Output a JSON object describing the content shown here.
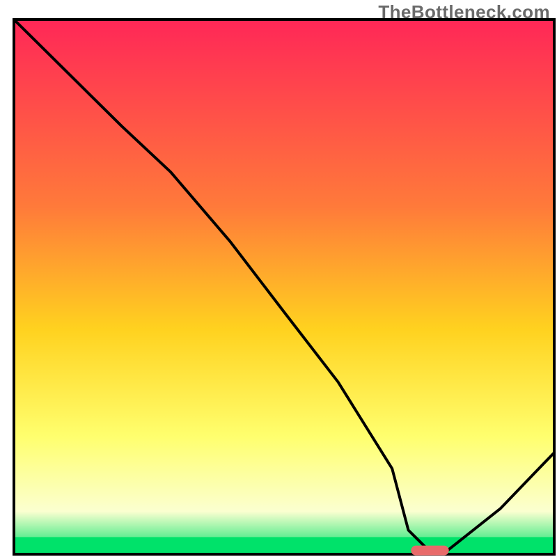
{
  "watermark": "TheBottleneck.com",
  "colors": {
    "gradient_top": "#ff2757",
    "gradient_mid1": "#ff7a3a",
    "gradient_mid2": "#ffd21f",
    "gradient_mid3": "#ffff6e",
    "gradient_mid4": "#fbffd0",
    "gradient_bottom_edge": "#00e26a",
    "green_band": "#00e26a",
    "curve": "#000000",
    "marker": "#e86a6a",
    "frame": "#000000",
    "page": "#ffffff"
  },
  "chart_data": {
    "type": "line",
    "title": "",
    "xlabel": "",
    "ylabel": "",
    "xlim": [
      0,
      100
    ],
    "ylim": [
      0,
      100
    ],
    "note": "Bottleneck-style curve. Higher y = worse (red), y≈0 at optimal point (green band). Values estimated from pixel positions; no axis labels in source.",
    "x": [
      0,
      10,
      20,
      29,
      40,
      50,
      60,
      70,
      73,
      77,
      80,
      90,
      100
    ],
    "values": [
      100,
      90,
      80,
      71.5,
      58.5,
      45.3,
      32.2,
      16,
      4.5,
      0.5,
      0.5,
      8.5,
      19
    ],
    "optimal_marker": {
      "x_start": 73.5,
      "x_end": 80.5,
      "y": 0.7
    },
    "green_band_y_fraction": 0.032
  }
}
